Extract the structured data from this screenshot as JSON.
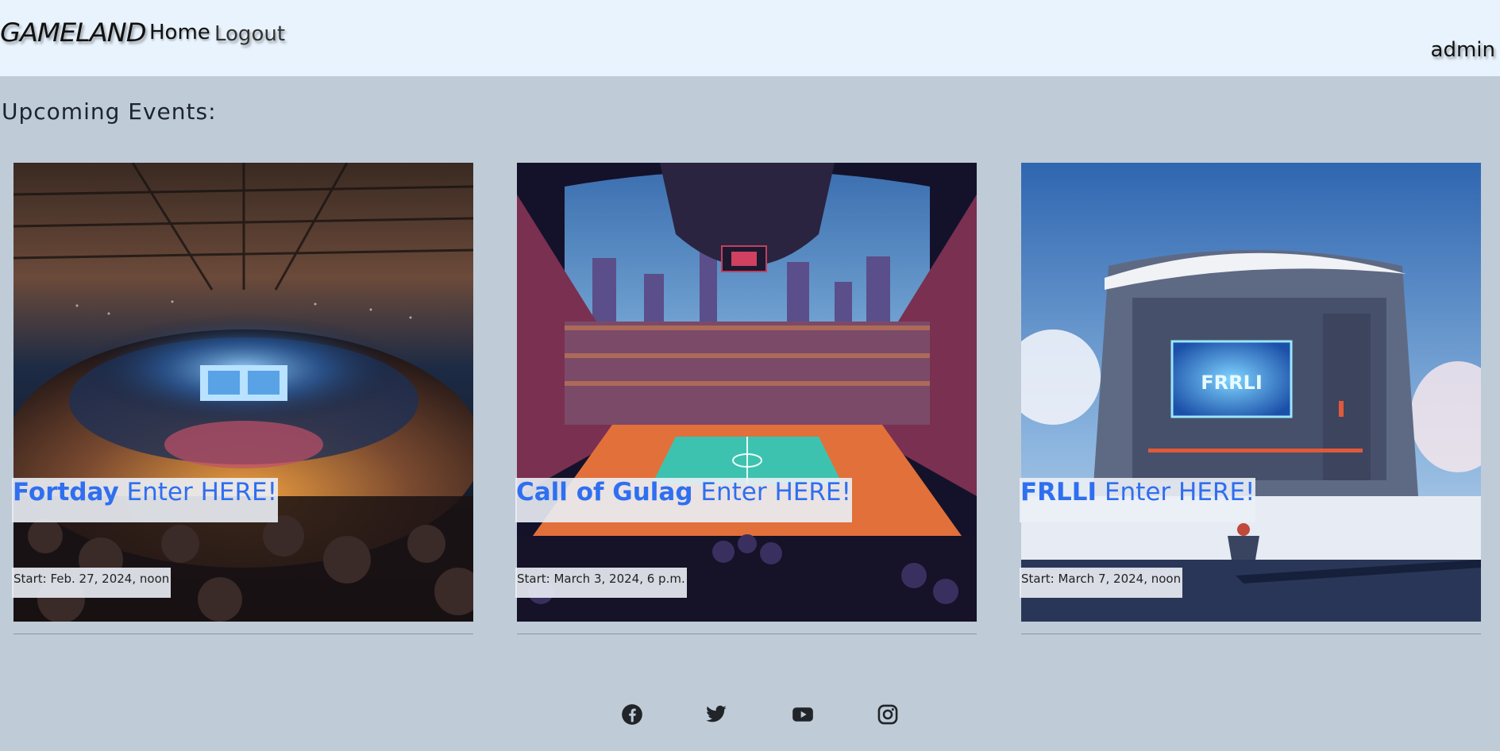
{
  "nav": {
    "brand": "GAMELAND",
    "home": "Home",
    "logout": "Logout",
    "user": "admin"
  },
  "heading": "Upcoming Events:",
  "events": [
    {
      "name": "Fortday",
      "cta": "Enter HERE!",
      "start": "Start: Feb. 27, 2024, noon"
    },
    {
      "name": "Call of Gulag",
      "cta": "Enter HERE!",
      "start": "Start: March 3, 2024, 6 p.m."
    },
    {
      "name": "FRLLI",
      "cta": "Enter HERE!",
      "start": "Start: March 7, 2024, noon",
      "sign_text": "FRRLI"
    }
  ],
  "footer": {
    "icons": [
      "facebook-icon",
      "twitter-icon",
      "youtube-icon",
      "instagram-icon"
    ]
  },
  "colors": {
    "page_bg": "#bfcbd7",
    "nav_bg": "#e8f3fd",
    "link_blue": "#2f6ff0"
  }
}
